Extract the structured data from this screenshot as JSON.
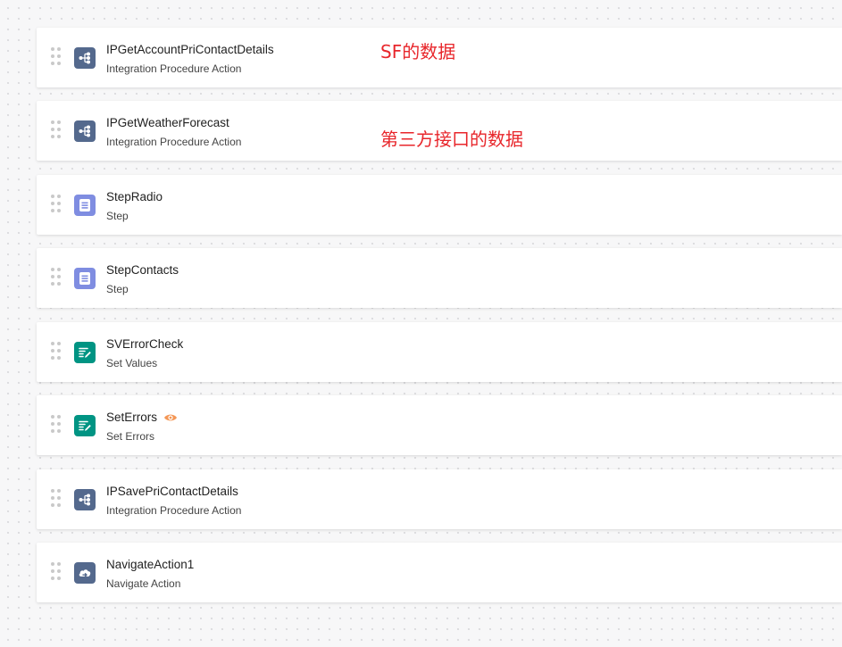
{
  "steps": [
    {
      "name": "IPGetAccountPriContactDetails",
      "type": "Integration Procedure Action",
      "icon": "integration-procedure-icon",
      "color": "#54698d"
    },
    {
      "name": "IPGetWeatherForecast",
      "type": "Integration Procedure Action",
      "icon": "integration-procedure-icon",
      "color": "#54698d"
    },
    {
      "name": "StepRadio",
      "type": "Step",
      "icon": "step-icon",
      "color": "#7f8de1"
    },
    {
      "name": "StepContacts",
      "type": "Step",
      "icon": "step-icon",
      "color": "#7f8de1"
    },
    {
      "name": "SVErrorCheck",
      "type": "Set Values",
      "icon": "set-values-icon",
      "color": "#009483"
    },
    {
      "name": "SetErrors",
      "type": "Set Errors",
      "icon": "set-values-icon",
      "color": "#009483",
      "badge_icon": "eye-icon",
      "badge_color": "#f49756"
    },
    {
      "name": "IPSavePriContactDetails",
      "type": "Integration Procedure Action",
      "icon": "integration-procedure-icon",
      "color": "#54698d"
    },
    {
      "name": "NavigateAction1",
      "type": "Navigate Action",
      "icon": "navigate-icon",
      "color": "#54698d"
    }
  ],
  "annotations": [
    {
      "text": "SF的数据",
      "color": "#e8262b"
    },
    {
      "text": "第三方接口的数据",
      "color": "#e8262b"
    }
  ]
}
